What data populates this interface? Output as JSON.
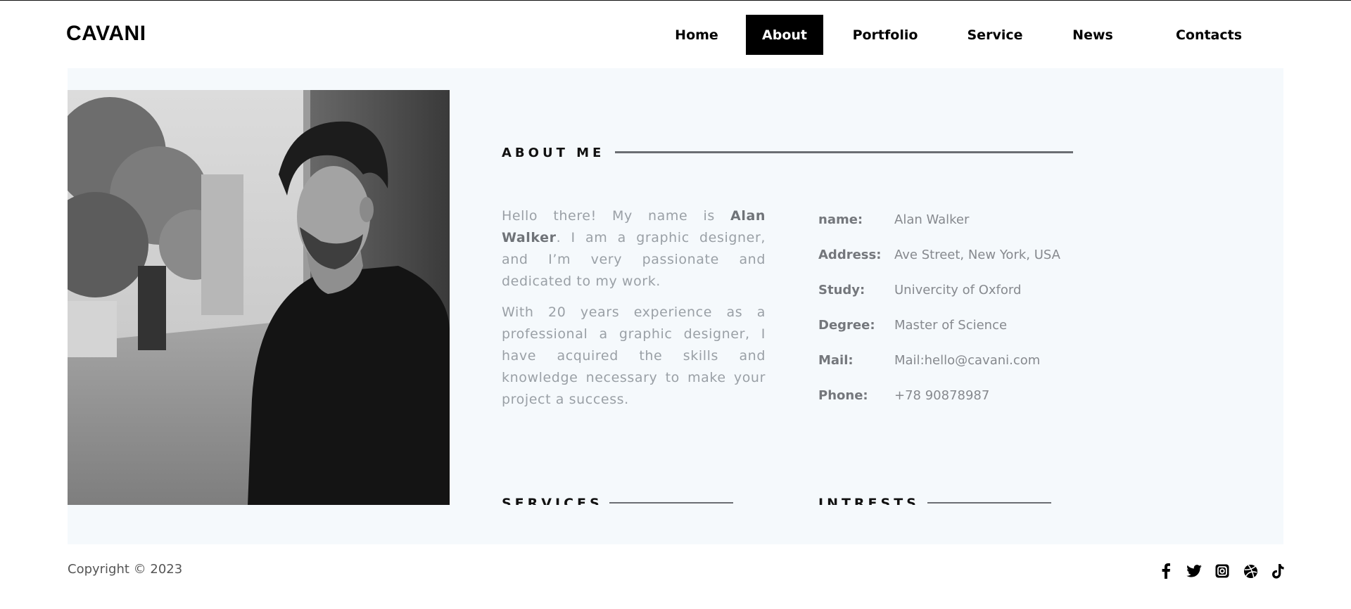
{
  "header": {
    "logo": "CAVANI",
    "nav": [
      {
        "label": "Home",
        "active": false
      },
      {
        "label": "About",
        "active": true
      },
      {
        "label": "Portfolio",
        "active": false
      },
      {
        "label": "Service",
        "active": false
      },
      {
        "label": "News",
        "active": false
      },
      {
        "label": "Contacts",
        "active": false
      }
    ]
  },
  "about": {
    "title": "ABOUT ME",
    "intro_pre": "Hello there! My name is ",
    "intro_name": "Alan Walker",
    "intro_post": ". I am a graphic designer, and I’m very passionate and dedicated to my work.",
    "paragraph2": "With 20 years experience as a professional a graphic designer, I have acquired the skills and knowledge necessary to make your project a success.",
    "info": [
      {
        "key": "name:",
        "value": "Alan Walker"
      },
      {
        "key": "Address:",
        "value": "Ave Street, New York, USA"
      },
      {
        "key": "Study:",
        "value": "Univercity of Oxford"
      },
      {
        "key": "Degree:",
        "value": "Master of Science"
      },
      {
        "key": "Mail:",
        "value": "Mail:hello@cavani.com"
      },
      {
        "key": "Phone:",
        "value": "+78 90878987"
      }
    ]
  },
  "services": {
    "title": "SERVICES"
  },
  "interests": {
    "title": "INTRESTS"
  },
  "footer": {
    "copyright": "Copyright © 2023",
    "socials": [
      "facebook-icon",
      "twitter-icon",
      "instagram-icon",
      "dribbble-icon",
      "tiktok-icon"
    ]
  },
  "colors": {
    "panel_bg": "#f5f9fc",
    "accent": "#000000",
    "muted_text": "#9aa0a6"
  }
}
